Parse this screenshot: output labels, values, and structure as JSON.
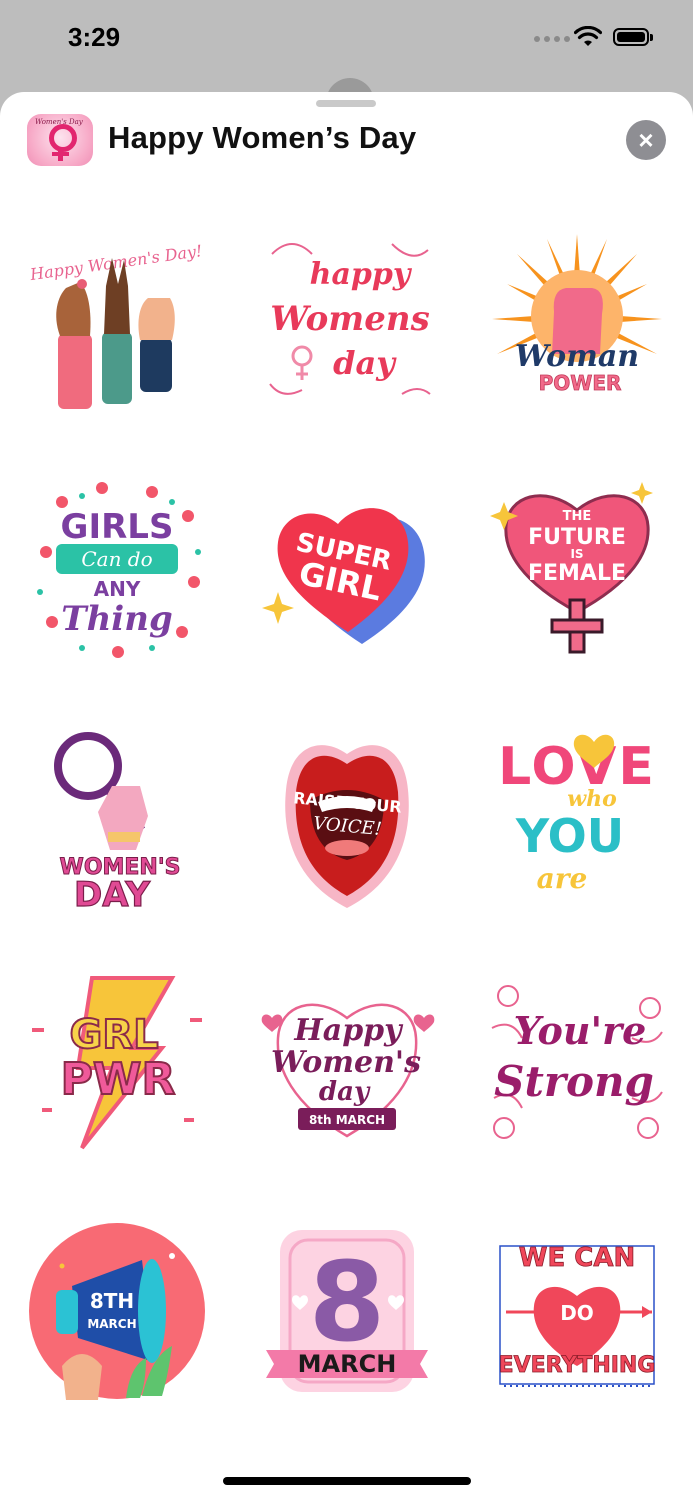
{
  "status": {
    "time": "3:29"
  },
  "header": {
    "title": "Happy Women’s Day",
    "icon_text": "Women's Day",
    "close_icon": "close-icon"
  },
  "colors": {
    "accent": "#e2266f",
    "sheet": "#ffffff",
    "backdrop": "#bdbdbd"
  },
  "stickers": [
    {
      "label_a": "Happy Women's Day!"
    },
    {
      "label_a": "happy",
      "label_b": "Womens",
      "label_c": "day"
    },
    {
      "label_a": "Woman",
      "label_b": "POWER"
    },
    {
      "label_a": "GIRLS",
      "label_b": "Can do",
      "label_c": "ANY",
      "label_d": "Thing"
    },
    {
      "label_a": "SUPER",
      "label_b": "GIRL"
    },
    {
      "label_a": "THE",
      "label_b": "FUTURE",
      "label_c": "IS",
      "label_d": "FEMALE"
    },
    {
      "label_a": "WOMEN'S",
      "label_b": "DAY"
    },
    {
      "label_a": "RAISE YOUR",
      "label_b": "VOICE!"
    },
    {
      "label_a": "LOVE",
      "label_b": "who",
      "label_c": "YOU",
      "label_d": "are"
    },
    {
      "label_a": "GRL",
      "label_b": "PWR"
    },
    {
      "label_a": "Happy",
      "label_b": "Women's",
      "label_c": "day",
      "label_d": "8th MARCH"
    },
    {
      "label_a": "You're",
      "label_b": "Strong"
    },
    {
      "label_a": "8TH",
      "label_b": "MARCH"
    },
    {
      "label_a": "8",
      "label_b": "MARCH"
    },
    {
      "label_a": "WE CAN",
      "label_b": "DO",
      "label_c": "EVERYTHING"
    }
  ]
}
